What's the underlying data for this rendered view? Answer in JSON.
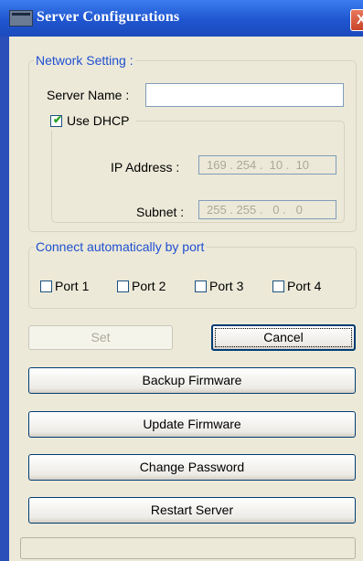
{
  "window": {
    "title": "Server Configurations",
    "close_glyph": "X"
  },
  "network": {
    "legend": "Network Setting :",
    "server_name_label": "Server Name :",
    "server_name_value": "",
    "dhcp_label": "Use DHCP",
    "dhcp_checked": true,
    "ip_label": "IP Address :",
    "ip_value": "169 . 254 .  10 .  10",
    "subnet_label": "Subnet :",
    "subnet_value": "255 . 255 .   0 .   0"
  },
  "ports": {
    "legend": "Connect automatically by port",
    "items": [
      {
        "label": "Port 1",
        "checked": false
      },
      {
        "label": "Port 2",
        "checked": false
      },
      {
        "label": "Port 3",
        "checked": false
      },
      {
        "label": "Port 4",
        "checked": false
      }
    ]
  },
  "buttons": {
    "set": "Set",
    "cancel": "Cancel",
    "backup": "Backup Firmware",
    "update": "Update Firmware",
    "change_password": "Change Password",
    "restart": "Restart Server"
  },
  "colors": {
    "title_bar": "#1f55cf",
    "group_legend": "#1f4fd1",
    "check_mark": "#21a121",
    "window_background": "#ece9d8"
  }
}
